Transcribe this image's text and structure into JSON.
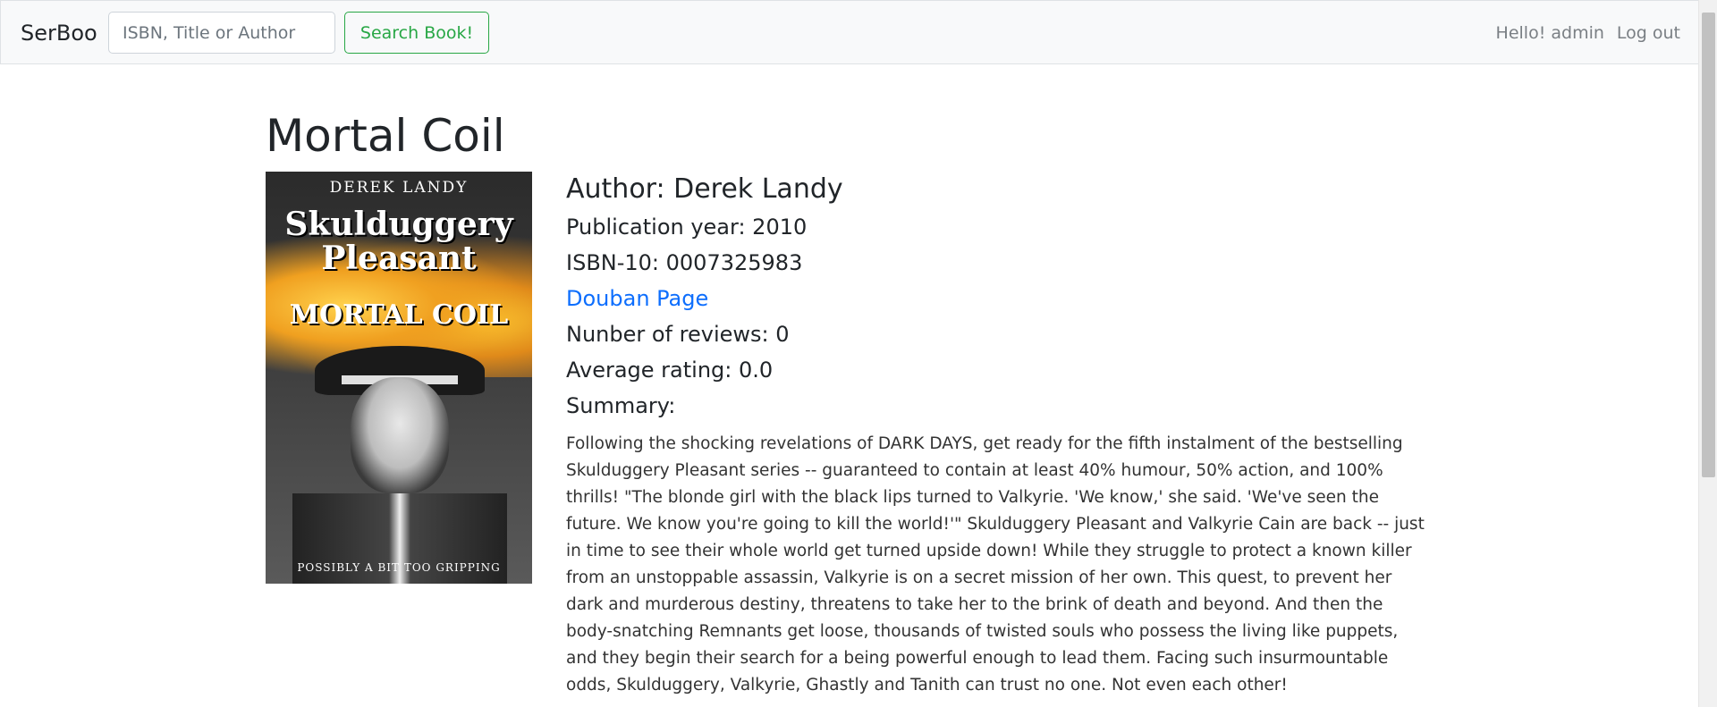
{
  "navbar": {
    "brand": "SerBoo",
    "search_placeholder": "ISBN, Title or Author",
    "search_button": "Search Book!",
    "greeting": "Hello! admin",
    "logout": "Log out"
  },
  "book": {
    "title": "Mortal Coil",
    "cover": {
      "author_text": "DEREK LANDY",
      "series_text": "Skulduggery Pleasant",
      "subtitle_text": "MORTAL COIL",
      "tagline_text": "POSSIBLY A BIT TOO GRIPPING"
    },
    "author_line": "Author: Derek Landy",
    "publication_line": "Publication year: 2010",
    "isbn_line": "ISBN-10: 0007325983",
    "douban_link": "Douban Page",
    "reviews_line": "Nunber of reviews: 0",
    "rating_line": "Average rating: 0.0",
    "summary_label": "Summary:",
    "summary": "Following the shocking revelations of DARK DAYS, get ready for the fifth instalment of the bestselling Skulduggery Pleasant series -- guaranteed to contain at least 40% humour, 50% action, and 100% thrills! \"The blonde girl with the black lips turned to Valkyrie. 'We know,' she said. 'We've seen the future. We know you're going to kill the world!'\" Skulduggery Pleasant and Valkyrie Cain are back -- just in time to see their whole world get turned upside down! While they struggle to protect a known killer from an unstoppable assassin, Valkyrie is on a secret mission of her own. This quest, to prevent her dark and murderous destiny, threatens to take her to the brink of death and beyond. And then the body-snatching Remnants get loose, thousands of twisted souls who possess the living like puppets, and they begin their search for a being powerful enough to lead them. Facing such insurmountable odds, Skulduggery, Valkyrie, Ghastly and Tanith can trust no one. Not even each other!"
  }
}
